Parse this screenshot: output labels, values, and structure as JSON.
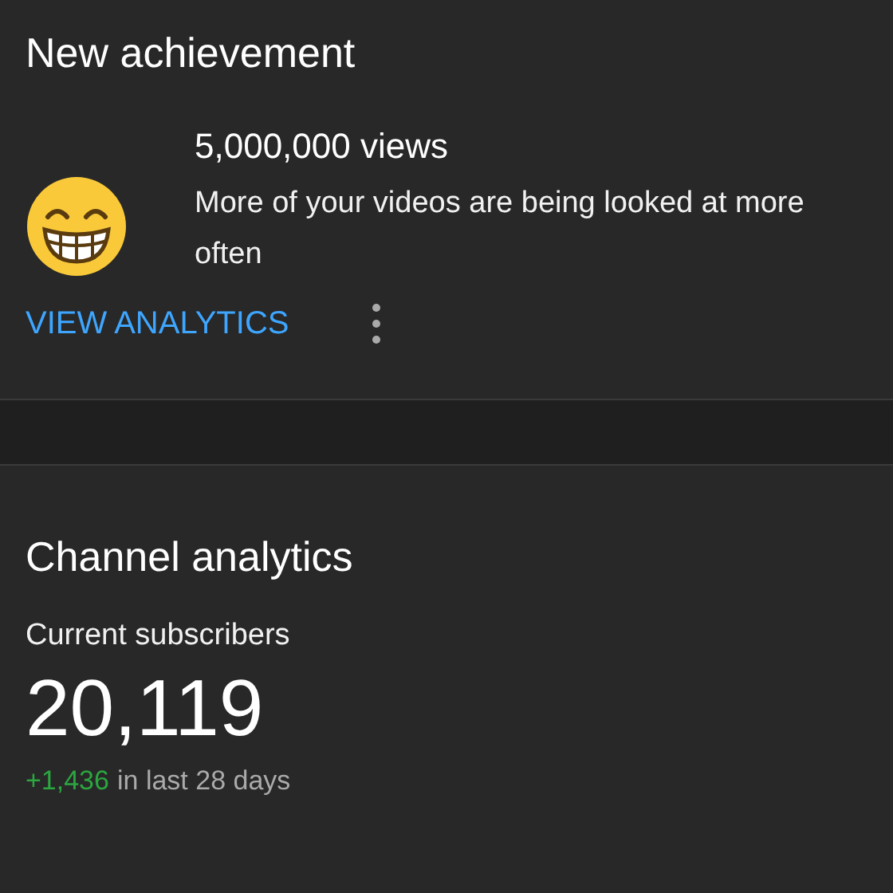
{
  "achievement": {
    "title": "New achievement",
    "headline": "5,000,000 views",
    "description": "More of your videos are being looked at more often",
    "action": "VIEW ANALYTICS"
  },
  "channel_analytics": {
    "title": "Channel analytics",
    "label": "Current subscribers",
    "count": "20,119",
    "change": "+1,436",
    "period": "in last 28 days"
  }
}
